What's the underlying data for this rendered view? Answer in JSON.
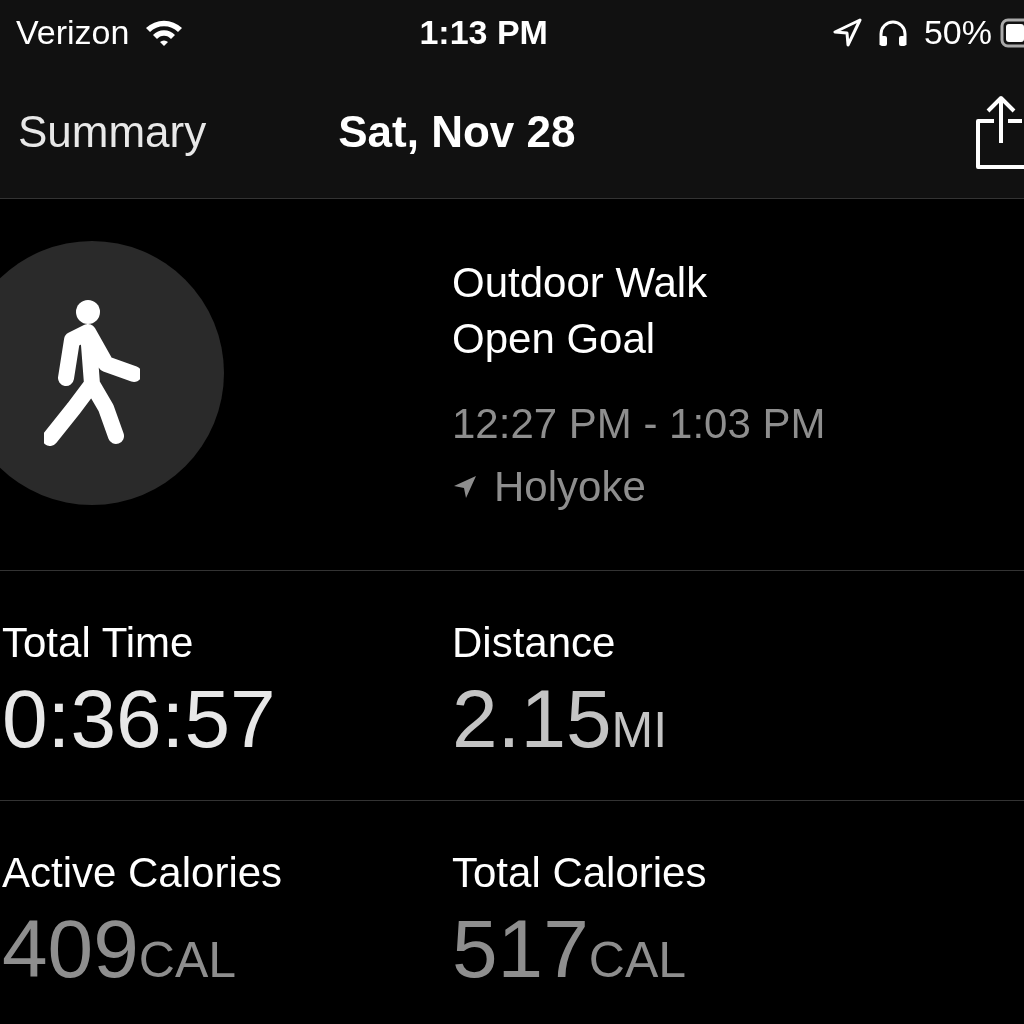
{
  "status_bar": {
    "carrier": "Verizon",
    "time": "1:13 PM",
    "battery": "50%"
  },
  "nav": {
    "back": "Summary",
    "title": "Sat, Nov 28"
  },
  "workout": {
    "name": "Outdoor Walk",
    "goal": "Open Goal",
    "time_range": "12:27 PM - 1:03 PM",
    "location": "Holyoke"
  },
  "metrics": [
    {
      "label": "Total Time",
      "value": "0:36:57",
      "color": "#e8e8e8"
    },
    {
      "label": "Distance",
      "value": "2.15",
      "unit": "MI",
      "color": "#c4c4c4"
    },
    {
      "label": "Active Calories",
      "value": "409",
      "unit": "CAL",
      "color": "#8e8e8e"
    },
    {
      "label": "Total Calories",
      "value": "517",
      "unit": "CAL",
      "color": "#8e8e8e"
    }
  ]
}
